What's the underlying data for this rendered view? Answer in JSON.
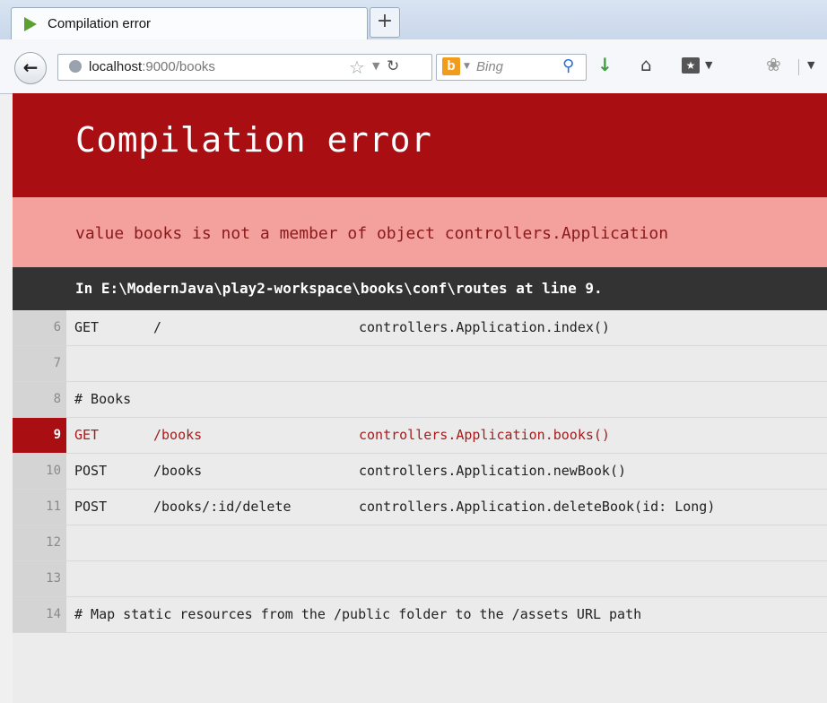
{
  "browser": {
    "tab_title": "Compilation error",
    "new_tab": "+",
    "url_host": "localhost",
    "url_port": ":9000/books",
    "search_placeholder": "Bing"
  },
  "error": {
    "title": "Compilation error",
    "message": "value books is not a member of object controllers.Application",
    "location": "In E:\\ModernJava\\play2-workspace\\books\\conf\\routes at line 9."
  },
  "code_lines": [
    {
      "num": "6",
      "method": "GET",
      "path": "/",
      "action": "controllers.Application.index()",
      "comment": ""
    },
    {
      "num": "7",
      "method": "",
      "path": "",
      "action": "",
      "comment": ""
    },
    {
      "num": "8",
      "method": "",
      "path": "",
      "action": "",
      "comment": "# Books"
    },
    {
      "num": "9",
      "method": "GET",
      "path": "/books",
      "action": "controllers.Application.books()",
      "comment": ""
    },
    {
      "num": "10",
      "method": "POST",
      "path": "/books",
      "action": "controllers.Application.newBook()",
      "comment": ""
    },
    {
      "num": "11",
      "method": "POST",
      "path": "/books/:id/delete",
      "action": "controllers.Application.deleteBook(id: Long)",
      "comment": ""
    },
    {
      "num": "12",
      "method": "",
      "path": "",
      "action": "",
      "comment": ""
    },
    {
      "num": "13",
      "method": "",
      "path": "",
      "action": "",
      "comment": ""
    },
    {
      "num": "14",
      "method": "",
      "path": "",
      "action": "",
      "comment": "# Map static resources from the /public folder to the /assets URL path"
    }
  ],
  "error_line": "9",
  "colors": {
    "header": "#a90e13",
    "message_bg": "#f4a19d",
    "location_bg": "#333333"
  }
}
